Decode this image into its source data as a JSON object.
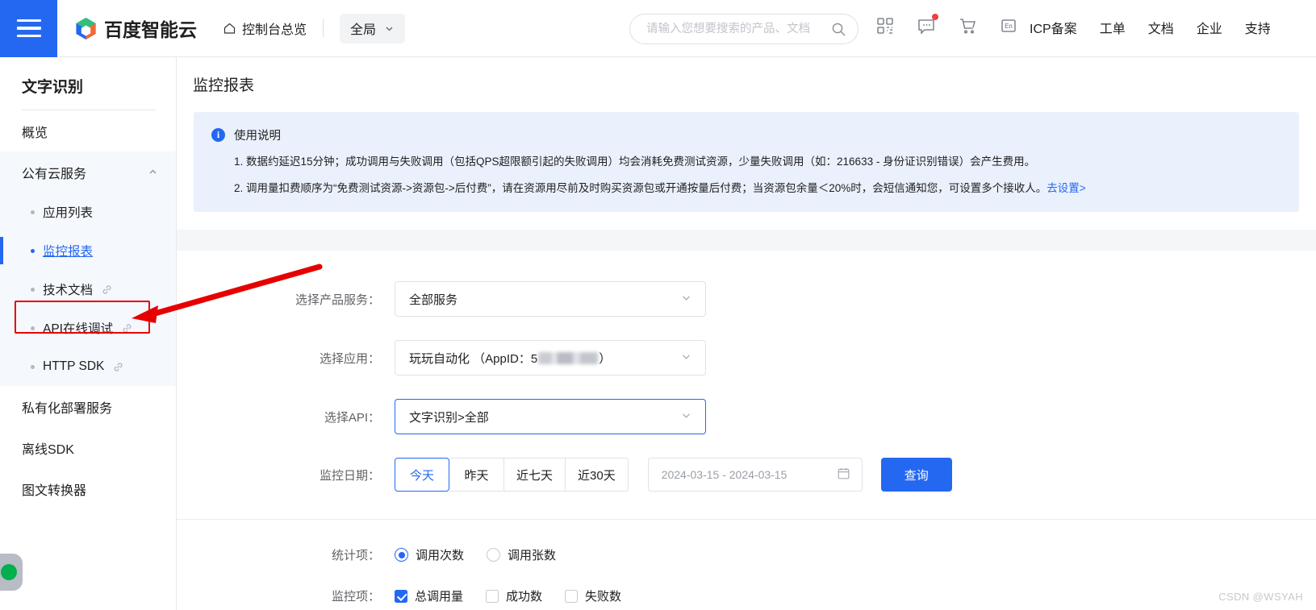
{
  "header": {
    "menu_icon": "hamburger-menu-icon",
    "brand": "百度智能云",
    "home_label": "控制台总览",
    "scope_label": "全局",
    "search_placeholder": "请输入您想要搜索的产品、文档",
    "icons": [
      "qrcode-icon",
      "message-icon",
      "cart-icon",
      "language-en-icon"
    ],
    "links": [
      "ICP备案",
      "工单",
      "文档",
      "企业",
      "支持"
    ]
  },
  "sidebar": {
    "title": "文字识别",
    "overview": "概览",
    "group_label": "公有云服务",
    "items": [
      {
        "label": "应用列表",
        "external": false
      },
      {
        "label": "监控报表",
        "external": false
      },
      {
        "label": "技术文档",
        "external": true
      },
      {
        "label": "API在线调试",
        "external": true
      },
      {
        "label": "HTTP SDK",
        "external": true
      }
    ],
    "bottom_items": [
      "私有化部署服务",
      "离线SDK",
      "图文转换器"
    ]
  },
  "main": {
    "page_title": "监控报表",
    "notice": {
      "title": "使用说明",
      "line1": "1. 数据约延迟15分钟；成功调用与失败调用（包括QPS超限额引起的失败调用）均会消耗免费测试资源，少量失败调用（如：216633 - 身份证识别错误）会产生费用。",
      "line2": "2. 调用量扣费顺序为“免费测试资源->资源包->后付费”，请在资源用尽前及时购买资源包或开通按量后付费；当资源包余量＜20%时，会短信通知您，可设置多个接收人。",
      "line2_link": "去设置>"
    },
    "form": {
      "product_label": "选择产品服务：",
      "product_value": "全部服务",
      "app_label": "选择应用：",
      "app_value_prefix": "玩玩自动化 （AppID：5",
      "app_value_suffix": "）",
      "api_label": "选择API：",
      "api_value": "文字识别>全部",
      "date_label": "监控日期：",
      "date_presets": [
        "今天",
        "昨天",
        "近七天",
        "近30天"
      ],
      "date_preset_active": "今天",
      "date_range_value": "2024-03-15 - 2024-03-15",
      "calendar_icon": "calendar-icon",
      "query_button": "查询",
      "stat_label": "统计项：",
      "stat_options": [
        {
          "label": "调用次数",
          "checked": true
        },
        {
          "label": "调用张数",
          "checked": false
        }
      ],
      "monitor_label": "监控项：",
      "monitor_options": [
        {
          "label": "总调用量",
          "checked": true
        },
        {
          "label": "成功数",
          "checked": false
        },
        {
          "label": "失败数",
          "checked": false
        }
      ]
    }
  },
  "annotations": {
    "highlight_color": "#e60000",
    "highlight_target": "API在线调试"
  },
  "float_widget": {
    "name": "floating-status-widget",
    "dot_color": "#00b04f"
  },
  "watermark": "CSDN @WSYAH",
  "colors": {
    "accent": "#2468f2",
    "notice_bg": "#eaf1fd",
    "annotation": "#e60000"
  }
}
